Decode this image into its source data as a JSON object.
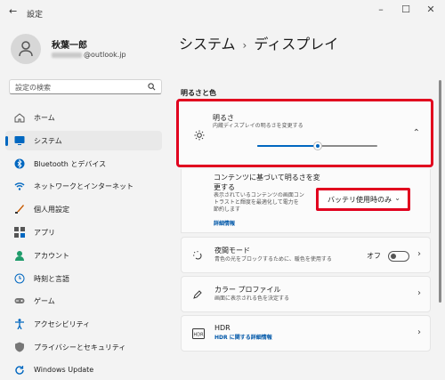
{
  "window": {
    "title": "設定"
  },
  "user": {
    "name": "秋葉一郎",
    "email_suffix": "@outlook.jp"
  },
  "search": {
    "placeholder": "設定の検索"
  },
  "nav": [
    {
      "label": "ホーム",
      "icon": "home-icon"
    },
    {
      "label": "システム",
      "icon": "monitor-icon",
      "active": true
    },
    {
      "label": "Bluetooth とデバイス",
      "icon": "bluetooth-icon"
    },
    {
      "label": "ネットワークとインターネット",
      "icon": "wifi-icon"
    },
    {
      "label": "個人用設定",
      "icon": "brush-icon"
    },
    {
      "label": "アプリ",
      "icon": "apps-icon"
    },
    {
      "label": "アカウント",
      "icon": "person-icon"
    },
    {
      "label": "時刻と言語",
      "icon": "globe-clock-icon"
    },
    {
      "label": "ゲーム",
      "icon": "gamepad-icon"
    },
    {
      "label": "アクセシビリティ",
      "icon": "accessibility-icon"
    },
    {
      "label": "プライバシーとセキュリティ",
      "icon": "shield-icon"
    },
    {
      "label": "Windows Update",
      "icon": "update-icon"
    }
  ],
  "page": {
    "breadcrumb_parent": "システム",
    "title": "ディスプレイ",
    "section_label": "明るさと色"
  },
  "brightness": {
    "title": "明るさ",
    "subtitle": "内蔵ディスプレイの明るさを変更する",
    "level_percent": 50
  },
  "content_brightness": {
    "title_line1": "コンテンツに基づいて明るさを変",
    "title_line2": "更する",
    "desc_line1": "表示されているコンテンツの画面コン",
    "desc_line2": "トラストと輝度を最適化して電力を",
    "desc_line3": "節約します",
    "link": "詳細情報",
    "dropdown_value": "バッテリ使用時のみ"
  },
  "night_light": {
    "title": "夜間モード",
    "subtitle": "青色の光をブロックするために、暖色を使用する",
    "toggle_label": "オフ"
  },
  "color_profile": {
    "title": "カラー プロファイル",
    "subtitle": "画面に表示される色を決定する"
  },
  "hdr": {
    "title": "HDR",
    "link": "HDR に関する詳細情報"
  },
  "colors": {
    "accent": "#0067c0",
    "highlight": "#e1001e"
  }
}
